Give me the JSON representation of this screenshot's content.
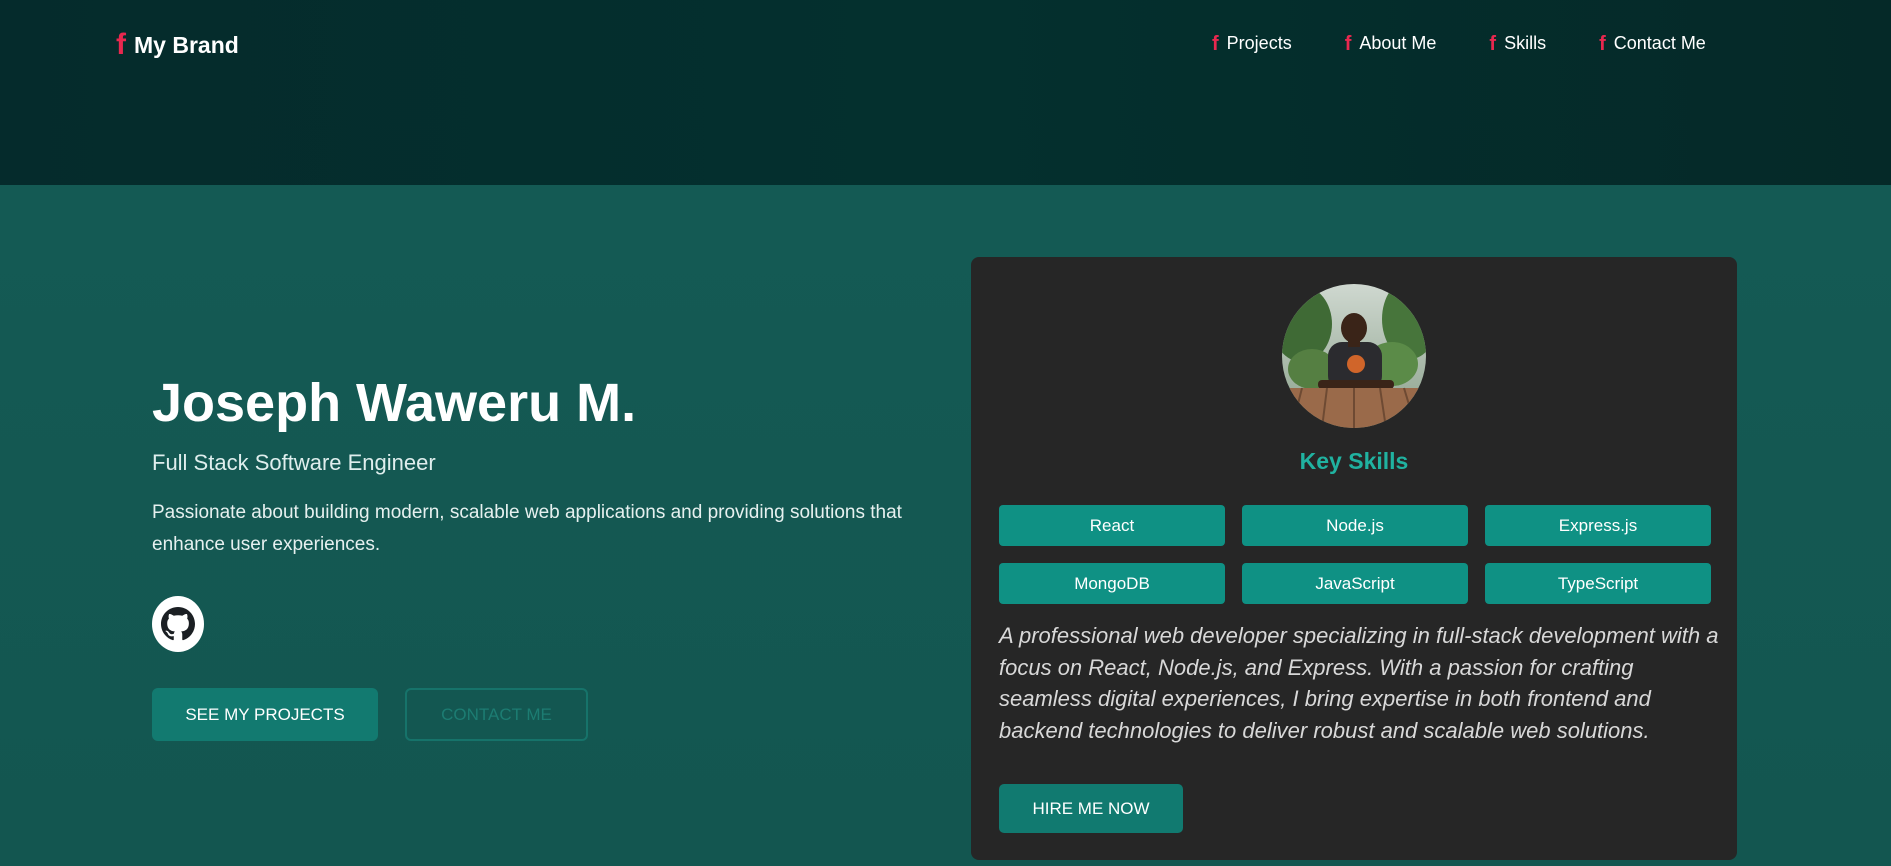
{
  "navbar": {
    "brand": "My Brand",
    "links": [
      {
        "label": "Projects"
      },
      {
        "label": "About Me"
      },
      {
        "label": "Skills"
      },
      {
        "label": "Contact Me"
      }
    ],
    "icon": "facebook-f-icon",
    "icon_color": "#e8284f"
  },
  "hero": {
    "name": "Joseph Waweru M.",
    "subtitle": "Full Stack Software Engineer",
    "intro": "Passionate about building modern, scalable web applications and providing solutions that enhance user experiences.",
    "github_icon": "github-icon",
    "primary_button": "See My Projects",
    "secondary_button": "Contact Me"
  },
  "card": {
    "avatar_icon": "profile-photo",
    "skills_title": "Key Skills",
    "skills": [
      "React",
      "Node.js",
      "Express.js",
      "MongoDB",
      "JavaScript",
      "TypeScript"
    ],
    "about": "A professional web developer specializing in full-stack development with a focus on React, Node.js, and Express. With a passion for crafting seamless digital experiences, I bring expertise in both frontend and backend technologies to deliver robust and scalable web solutions.",
    "hire_button": "Hire Me Now"
  },
  "colors": {
    "accent": "#20b2a0",
    "button": "#127a70",
    "card_bg": "#262626",
    "hero_bg": "#135650",
    "nav_bg": "#04302e"
  }
}
